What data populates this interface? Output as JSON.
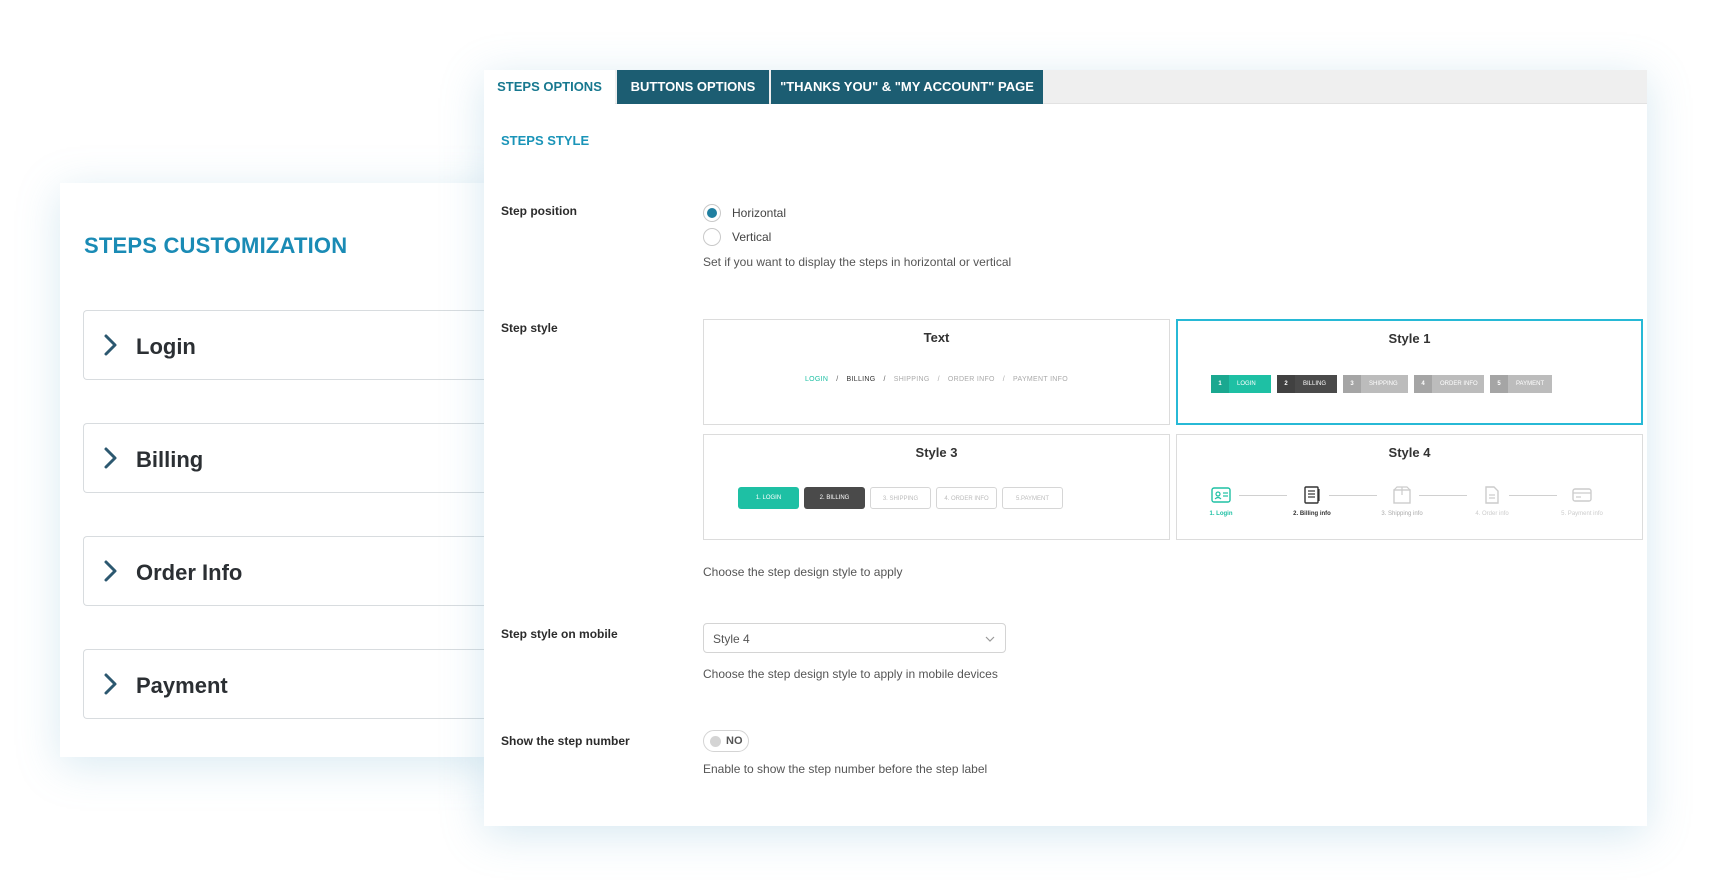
{
  "left": {
    "title": "STEPS CUSTOMIZATION",
    "items": [
      {
        "label": "Login"
      },
      {
        "label": "Billing"
      },
      {
        "label": "Order Info"
      },
      {
        "label": "Payment"
      }
    ]
  },
  "tabs": [
    {
      "label": "STEPS OPTIONS",
      "active": true
    },
    {
      "label": "BUTTONS OPTIONS",
      "active": false
    },
    {
      "label": "\"THANKS YOU\" & \"MY ACCOUNT\" PAGE",
      "active": false
    }
  ],
  "section_title": "STEPS STYLE",
  "step_position": {
    "label": "Step position",
    "options": [
      "Horizontal",
      "Vertical"
    ],
    "selected": "Horizontal",
    "help": "Set if you want to display the steps in horizontal or vertical"
  },
  "step_style": {
    "label": "Step style",
    "selected": "Style 1",
    "help": "Choose the step design style to apply",
    "styles": {
      "text": {
        "title": "Text",
        "steps": [
          "LOGIN",
          "BILLING",
          "SHIPPING",
          "ORDER INFO",
          "PAYMENT INFO"
        ],
        "separator": "/"
      },
      "style1": {
        "title": "Style 1",
        "steps": [
          {
            "num": "1",
            "label": "LOGIN"
          },
          {
            "num": "2",
            "label": "BILLING"
          },
          {
            "num": "3",
            "label": "SHIPPING"
          },
          {
            "num": "4",
            "label": "ORDER INFO"
          },
          {
            "num": "5",
            "label": "PAYMENT"
          }
        ]
      },
      "style3": {
        "title": "Style 3",
        "steps": [
          "1. LOGIN",
          "2. BILLING",
          "3. SHIPPING",
          "4. ORDER INFO",
          "5.PAYMENT"
        ]
      },
      "style4": {
        "title": "Style 4",
        "steps": [
          "1. Login",
          "2. Billing info",
          "3. Shipping info",
          "4. Order info",
          "5. Payment info"
        ]
      }
    }
  },
  "mobile_style": {
    "label": "Step style on mobile",
    "value": "Style 4",
    "help": "Choose the step design style to apply in mobile devices"
  },
  "show_number": {
    "label": "Show the step number",
    "toggle": "NO",
    "help": "Enable to show the step number before the step label"
  },
  "colors": {
    "accent": "#1a94b8",
    "teal": "#1ec0a4",
    "dark_tab": "#1c5d72",
    "selected_border": "#27b9d6"
  }
}
